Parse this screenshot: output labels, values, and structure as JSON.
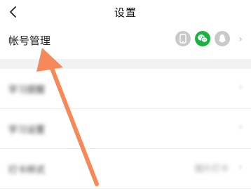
{
  "header": {
    "title": "设置"
  },
  "account": {
    "label": "帐号管理",
    "bound_icons": [
      "phone-icon",
      "wechat-icon",
      "qq-icon"
    ],
    "chevron": "›"
  },
  "settings_rows": [
    {
      "label": "学习提醒",
      "value": "",
      "chevron": "›"
    },
    {
      "label": "学习设置",
      "value": "",
      "chevron": "›"
    },
    {
      "label": "打卡样式",
      "value": "图片打卡",
      "chevron": "›"
    }
  ],
  "colors": {
    "wechat": "#19b241",
    "arrow": "#f5895a",
    "inactive_icon": "#c9c9c9"
  }
}
